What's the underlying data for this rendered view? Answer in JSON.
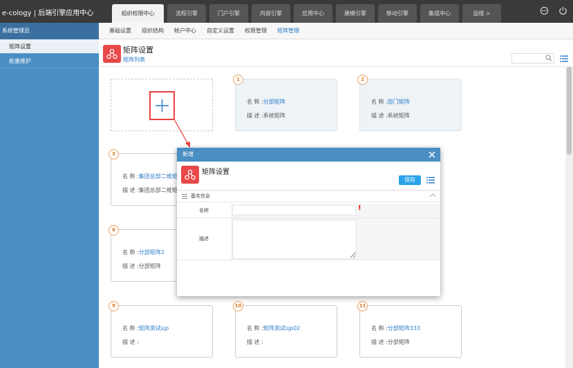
{
  "app": {
    "title": "e-cology | 后端引擎应用中心"
  },
  "topnav": {
    "tabs": [
      "组织权限中心",
      "流程引擎",
      "门户引擎",
      "内容引擎",
      "应用中心",
      "建模引擎",
      "移动引擎",
      "集成中心",
      "运维 >"
    ]
  },
  "sidebar": {
    "header": "系统管理员",
    "items": [
      "矩阵设置",
      "批量维护"
    ]
  },
  "subnav": {
    "items": [
      "基础设置",
      "组织结构",
      "帐户中心",
      "自定义设置",
      "权限管理",
      "矩阵管理"
    ]
  },
  "page": {
    "title": "矩阵设置",
    "subtitle": "矩阵列表"
  },
  "cards": [
    {
      "num": "1",
      "name_label": "名 称 :",
      "name": "分部矩阵",
      "desc": "描 述 :系统矩阵"
    },
    {
      "num": "2",
      "name_label": "名 称 :",
      "name": "部门矩阵",
      "desc": "描 述 :系统矩阵"
    },
    {
      "num": "3",
      "name_label": "名 称 :",
      "name": "集团总部二维矩阵",
      "desc": "描 述 :集团总部二维矩阵"
    },
    {
      "num": "6",
      "name_label": "名 称 :",
      "name": "分部矩阵2",
      "desc": "描 述 :分部矩阵"
    },
    {
      "num": "9",
      "name_label": "名 称 :",
      "name": "矩阵测试sjp",
      "desc": "描 述 :"
    },
    {
      "num": "10",
      "name_label": "名 称 :",
      "name": "矩阵测试sjp02",
      "desc": "描 述 :"
    },
    {
      "num": "11",
      "name_label": "名 称 :",
      "name": "分部矩阵333",
      "desc": "描 述 :分部矩阵"
    }
  ],
  "modal": {
    "title": "新增",
    "heading": "矩阵设置",
    "save_label": "保存",
    "section_label": "基本信息",
    "name_label": "名称",
    "name_value": "",
    "required_mark": "!",
    "desc_label": "描述",
    "desc_value": ""
  },
  "colors": {
    "accent": "#4a8fc4",
    "brand_red": "#e84848",
    "save_blue": "#2aa3e8",
    "number_orange": "#e07a20"
  }
}
